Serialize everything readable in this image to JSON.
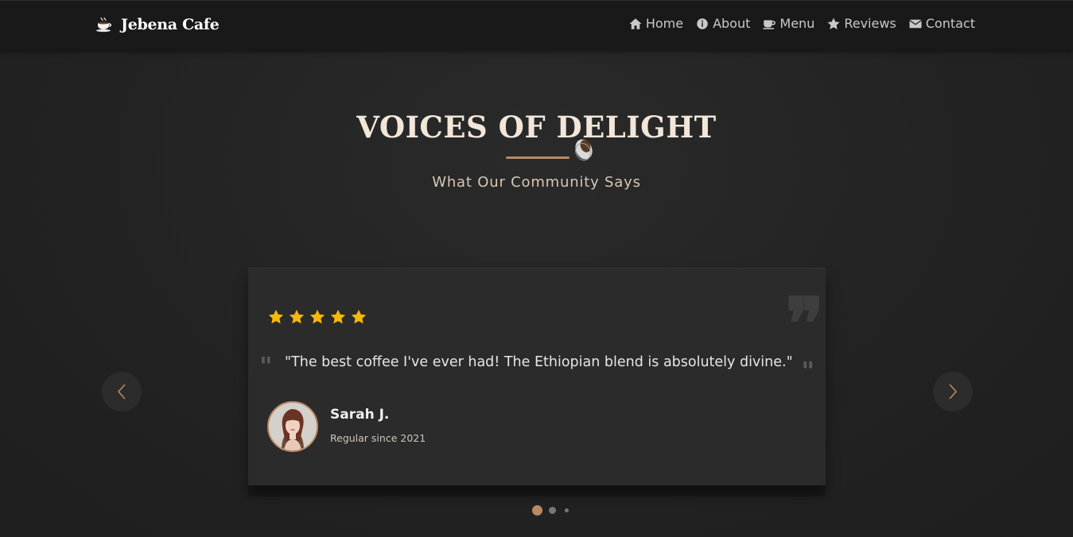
{
  "brand": {
    "name": "Jebena Cafe",
    "icon": "coffee-cup-icon"
  },
  "nav": {
    "items": [
      {
        "label": "Home",
        "icon": "home-icon"
      },
      {
        "label": "About",
        "icon": "info-icon"
      },
      {
        "label": "Menu",
        "icon": "mug-icon"
      },
      {
        "label": "Reviews",
        "icon": "star-icon"
      },
      {
        "label": "Contact",
        "icon": "envelope-icon"
      }
    ]
  },
  "section": {
    "title": "VOICES OF DELIGHT",
    "subtitle": "What Our Community Says"
  },
  "testimonial": {
    "rating": 5,
    "quote": "\"The best coffee I've ever had! The Ethiopian blend is absolutely divine.\"",
    "author": "Sarah J.",
    "meta": "Regular since 2021"
  },
  "carousel": {
    "slides": 3,
    "active": 1
  },
  "colors": {
    "accent": "#b88a63",
    "star": "#f5b90a",
    "background": "#232323",
    "navbar": "#191919"
  }
}
